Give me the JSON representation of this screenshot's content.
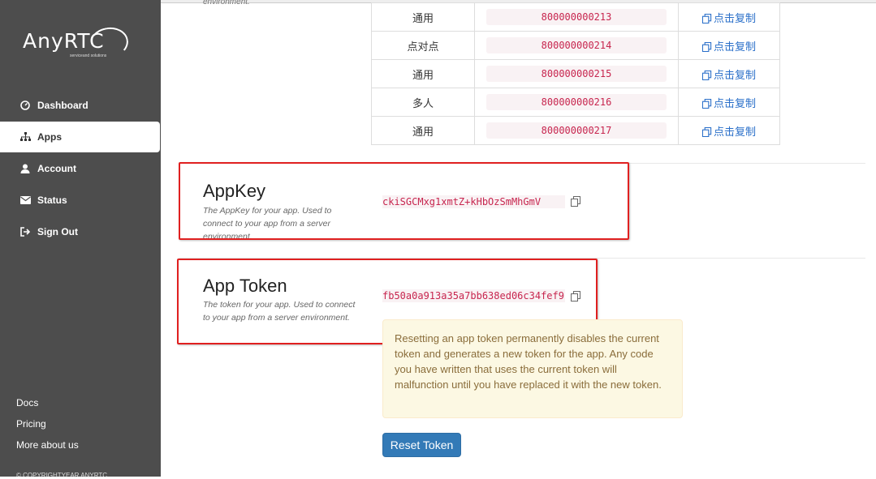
{
  "sidebar": {
    "logo_text": "AnyRTC",
    "logo_sub": "serviceand solutions",
    "nav": [
      {
        "label": "Dashboard",
        "icon": "dashboard-icon"
      },
      {
        "label": "Apps",
        "icon": "apps-icon"
      },
      {
        "label": "Account",
        "icon": "user-icon"
      },
      {
        "label": "Status",
        "icon": "envelope-icon"
      },
      {
        "label": "Sign Out",
        "icon": "sign-out-icon"
      }
    ],
    "active": "Apps",
    "footer_links": [
      "Docs",
      "Pricing",
      "More about us"
    ],
    "copyright": "© COPYRIGHTYEAR ANYRTC"
  },
  "top_desc_fragment": "environment.",
  "rooms": {
    "copy_label": "点击复制",
    "rows": [
      {
        "type": "通用",
        "id": "800000000213"
      },
      {
        "type": "点对点",
        "id": "800000000214"
      },
      {
        "type": "通用",
        "id": "800000000215"
      },
      {
        "type": "多人",
        "id": "800000000216"
      },
      {
        "type": "通用",
        "id": "800000000217"
      }
    ]
  },
  "appkey": {
    "title": "AppKey",
    "desc": "The AppKey for your app. Used to connect to your app from a server environment.",
    "value": "ckiSGCMxg1xmtZ+kHbOzSmMhGmV"
  },
  "apptoken": {
    "title": "App Token",
    "desc": "The token for your app. Used to connect to your app from a server environment.",
    "value": "fb50a0a913a35a7bb638ed06c34fef9",
    "warning": "Resetting an app token permanently disables the current token and generates a new token for the app. Any code you have written that uses the current token will malfunction until you have replaced it with the new token.",
    "reset_label": "Reset Token"
  },
  "colors": {
    "sidebar": "#4d4d4d",
    "highlight": "#e02020",
    "link": "#2a6fc9",
    "button": "#337ab7"
  }
}
